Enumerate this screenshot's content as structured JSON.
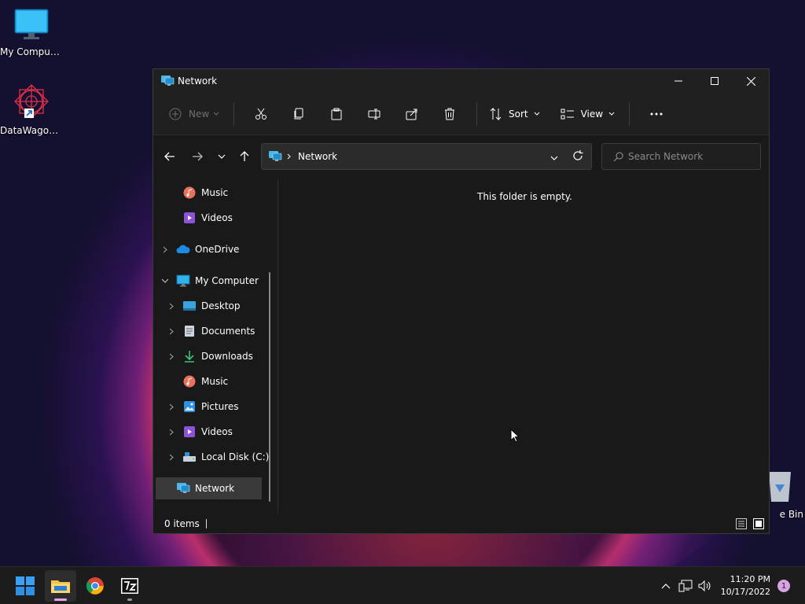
{
  "desktop": {
    "icons": [
      {
        "label": "My Computer"
      },
      {
        "label": "DataWagon..."
      },
      {
        "label": "e Bin"
      }
    ]
  },
  "window": {
    "title": "Network",
    "toolbar": {
      "new_label": "New",
      "sort_label": "Sort",
      "view_label": "View"
    },
    "address": {
      "crumb": "Network"
    },
    "search": {
      "placeholder": "Search Network"
    },
    "nav": {
      "items": [
        {
          "label": "Music"
        },
        {
          "label": "Videos"
        },
        {
          "label": "OneDrive"
        },
        {
          "label": "My Computer"
        },
        {
          "label": "Desktop"
        },
        {
          "label": "Documents"
        },
        {
          "label": "Downloads"
        },
        {
          "label": "Music"
        },
        {
          "label": "Pictures"
        },
        {
          "label": "Videos"
        },
        {
          "label": "Local Disk (C:)"
        },
        {
          "label": "Network"
        }
      ]
    },
    "content": {
      "empty_message": "This folder is empty."
    },
    "status": {
      "items_count": "0 items"
    }
  },
  "taskbar": {
    "clock_time": "11:20 PM",
    "clock_date": "10/17/2022",
    "notification_count": "1"
  },
  "colors": {
    "accent": "#0078d4",
    "window_bg": "#191919",
    "taskbar_bg": "#1c1c1c"
  }
}
